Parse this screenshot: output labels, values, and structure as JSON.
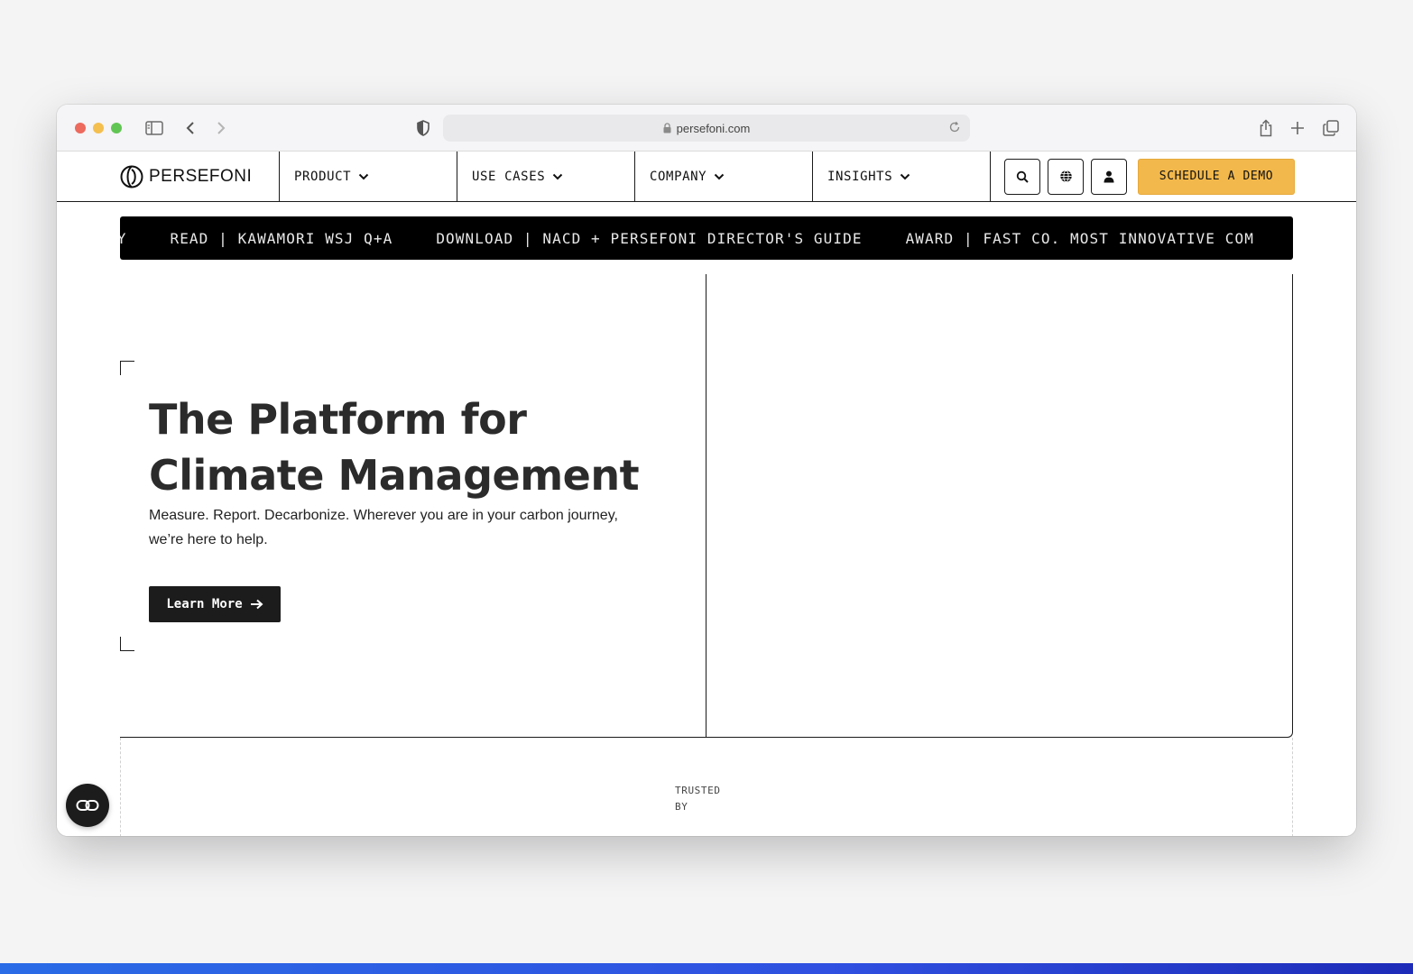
{
  "browser": {
    "url": "persefoni.com",
    "icons": [
      "sidebar-icon",
      "back-icon",
      "forward-icon",
      "shield-icon",
      "lock-icon",
      "reload-icon",
      "share-icon",
      "new-tab-icon",
      "tabs-overview-icon"
    ]
  },
  "nav": {
    "logo": "PERSEFONI",
    "items": [
      {
        "label": "PRODUCT"
      },
      {
        "label": "USE CASES"
      },
      {
        "label": "COMPANY"
      },
      {
        "label": "INSIGHTS"
      }
    ],
    "cta": "SCHEDULE A DEMO",
    "cta_color": "#f2b84b"
  },
  "ticker": {
    "items": [
      "CY",
      "READ | KAWAMORI WSJ Q+A",
      "DOWNLOAD | NACD + PERSEFONI DIRECTOR'S GUIDE",
      "AWARD | FAST CO. MOST INNOVATIVE COM"
    ]
  },
  "hero": {
    "title": "The Platform for Climate Management",
    "subtitle": "Measure. Report. Decarbonize. Wherever you are in your carbon journey, we’re here to help.",
    "button": "Learn More"
  },
  "trusted": {
    "line1": "TRUSTED",
    "line2": "BY"
  }
}
